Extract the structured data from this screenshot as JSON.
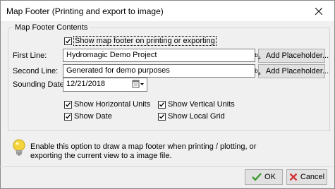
{
  "window": {
    "title": "Map Footer (Printing and export to image)"
  },
  "group": {
    "title": "Map Footer Contents"
  },
  "show_footer": {
    "label": "Show map footer on printing or exporting",
    "checked": true
  },
  "first_line": {
    "label": "First Line:",
    "value": "Hydromagic Demo Project",
    "button": "Add Placeholder..."
  },
  "second_line": {
    "label": "Second Line:",
    "value": "Generated for demo purposes",
    "button": "Add Placeholder..."
  },
  "sounding_date": {
    "label": "Sounding Date:",
    "value": "12/21/2018"
  },
  "options": {
    "show_horizontal_units": {
      "label": "Show Horizontal Units",
      "checked": true
    },
    "show_vertical_units": {
      "label": "Show Vertical Units",
      "checked": true
    },
    "show_date": {
      "label": "Show Date",
      "checked": true
    },
    "show_local_grid": {
      "label": "Show Local Grid",
      "checked": true
    }
  },
  "info": {
    "line1": "Enable this option to draw a map footer when printing / plotting, or",
    "line2": "exporting the current view to a image file."
  },
  "buttons": {
    "ok": "OK",
    "cancel": "Cancel"
  },
  "colors": {
    "ok_green": "#3a9b2c",
    "cancel_red": "#d13438",
    "bulb_yellow": "#f5d33a"
  }
}
